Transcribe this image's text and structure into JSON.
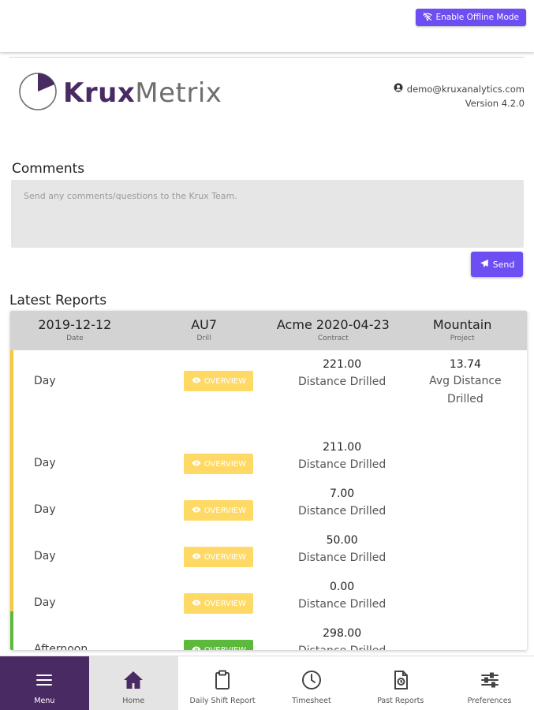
{
  "topbar": {
    "offline_label": "Enable Offline Mode"
  },
  "brand": {
    "part1": "Krux",
    "part2": "Metrix",
    "accent": "#4a2a63",
    "button_color": "#6c4ef2"
  },
  "account": {
    "email": "demo@kruxanalytics.com",
    "version": "Version 4.2.0"
  },
  "comments": {
    "title": "Comments",
    "placeholder": "Send any comments/questions to the Krux Team.",
    "send_label": "Send"
  },
  "reports": {
    "title": "Latest Reports",
    "header": [
      {
        "value": "2019-12-12",
        "label": "Date"
      },
      {
        "value": "AU7",
        "label": "Drill"
      },
      {
        "value": "Acme 2020-04-23",
        "label": "Contract"
      },
      {
        "value": "Mountain",
        "label": "Project"
      }
    ],
    "overview_label": "OVERVIEW",
    "rows": [
      {
        "shift": "Day",
        "value": "221.00",
        "label": "Distance Drilled",
        "avg_value": "13.74",
        "avg_label_1": "Avg Distance",
        "avg_label_2": "Drilled",
        "status": "yellow"
      },
      {
        "shift": "Day",
        "value": "211.00",
        "label": "Distance Drilled",
        "status": "yellow"
      },
      {
        "shift": "Day",
        "value": "7.00",
        "label": "Distance Drilled",
        "status": "yellow"
      },
      {
        "shift": "Day",
        "value": "50.00",
        "label": "Distance Drilled",
        "status": "yellow"
      },
      {
        "shift": "Day",
        "value": "0.00",
        "label": "Distance Drilled",
        "status": "yellow"
      },
      {
        "shift": "Afternoon",
        "value": "298.00",
        "label": "Distance Drilled",
        "status": "green"
      }
    ]
  },
  "nav": [
    {
      "label": "Menu",
      "icon": "hamburger-icon"
    },
    {
      "label": "Home",
      "icon": "home-icon"
    },
    {
      "label": "Daily Shift Report",
      "icon": "clipboard-icon"
    },
    {
      "label": "Timesheet",
      "icon": "clock-icon"
    },
    {
      "label": "Past Reports",
      "icon": "file-history-icon"
    },
    {
      "label": "Preferences",
      "icon": "sliders-icon"
    }
  ]
}
